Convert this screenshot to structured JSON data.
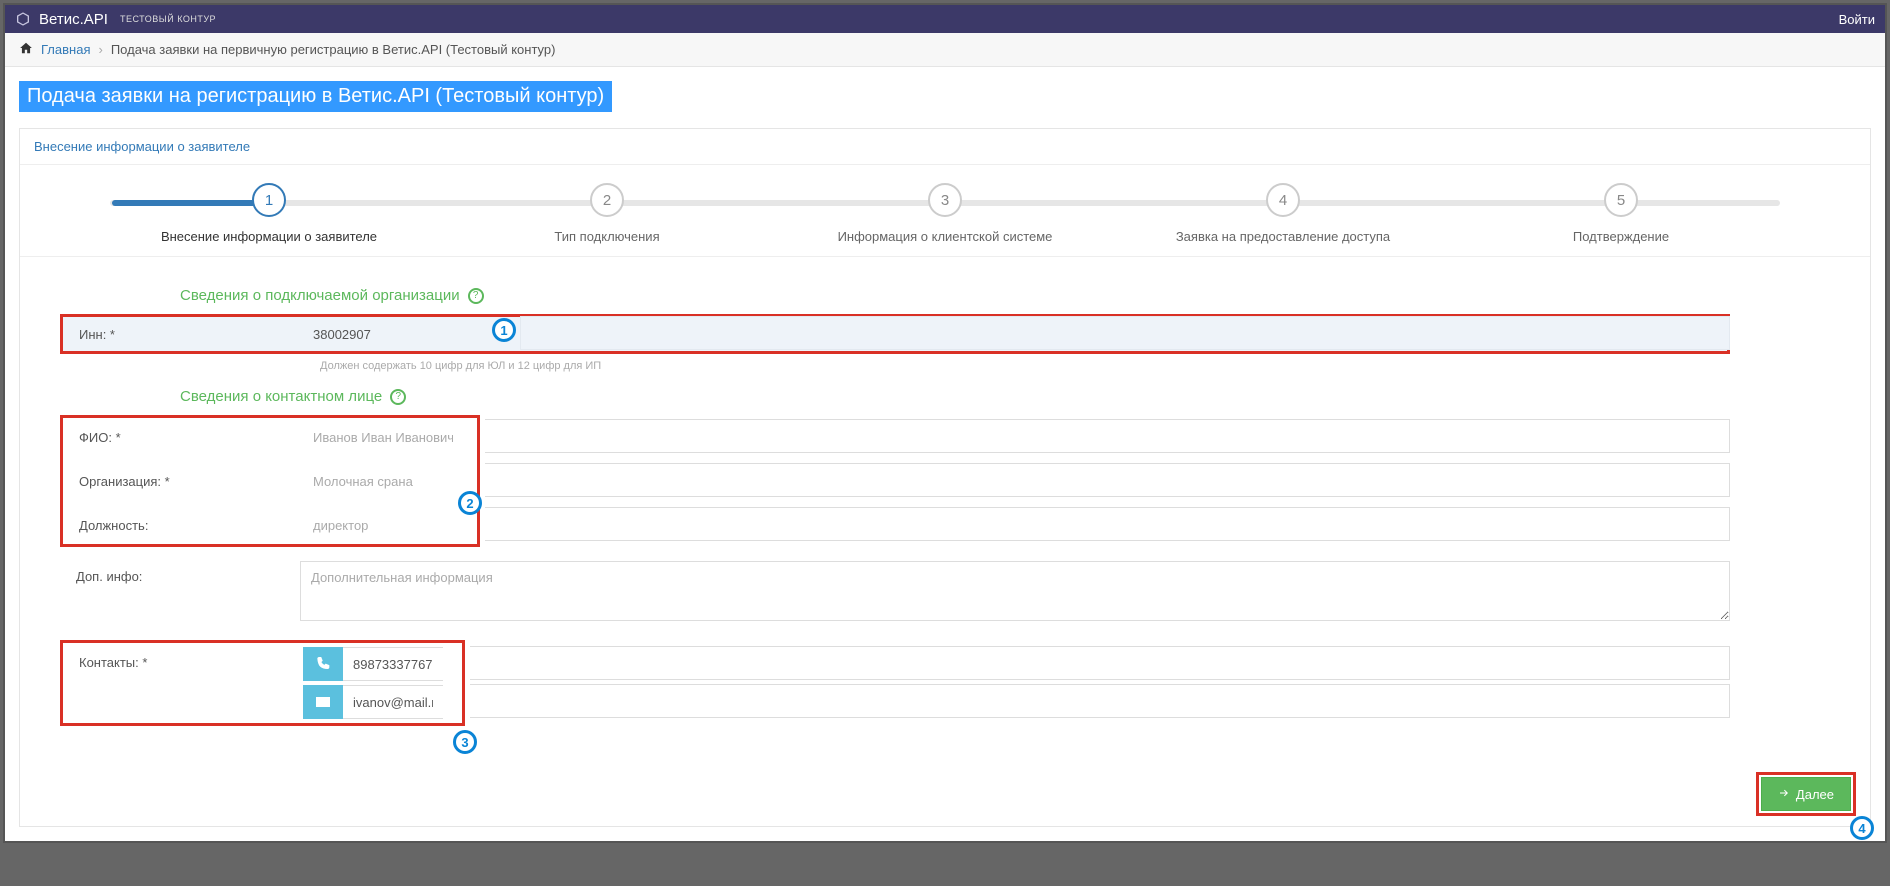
{
  "topbar": {
    "brand": "Ветис.API",
    "env": "ТЕСТОВЫЙ КОНТУР",
    "login": "Войти"
  },
  "breadcrumb": {
    "home": "Главная",
    "current": "Подача заявки на первичную регистрацию в Ветис.API (Тестовый контур)"
  },
  "page_title": "Подача заявки на регистрацию в Ветис.API (Тестовый контур)",
  "panel_subtitle": "Внесение информации о заявителе",
  "wizard": [
    {
      "num": "1",
      "label": "Внесение информации о заявителе"
    },
    {
      "num": "2",
      "label": "Тип подключения"
    },
    {
      "num": "3",
      "label": "Информация о клиентской системе"
    },
    {
      "num": "4",
      "label": "Заявка на предоставление доступа"
    },
    {
      "num": "5",
      "label": "Подтверждение"
    }
  ],
  "sections": {
    "org_title": "Сведения о подключаемой организации",
    "contact_title": "Сведения о контактном лице"
  },
  "labels": {
    "inn": "Инн: *",
    "fio": "ФИО: *",
    "org": "Организация: *",
    "position": "Должность:",
    "extra": "Доп. инфо:",
    "contacts": "Контакты: *"
  },
  "values": {
    "inn": "38002907",
    "fio": "Иванов Иван Иванович",
    "org": "Молочная срана",
    "position": "директор",
    "phone": "89873337767",
    "email": "ivanov@mail.ru"
  },
  "placeholders": {
    "extra": "Дополнительная информация"
  },
  "hints": {
    "inn": "Должен содержать 10 цифр для ЮЛ и 12 цифр для ИП"
  },
  "buttons": {
    "next": "Далее"
  },
  "callouts": {
    "c1": "1",
    "c2": "2",
    "c3": "3",
    "c4": "4"
  }
}
